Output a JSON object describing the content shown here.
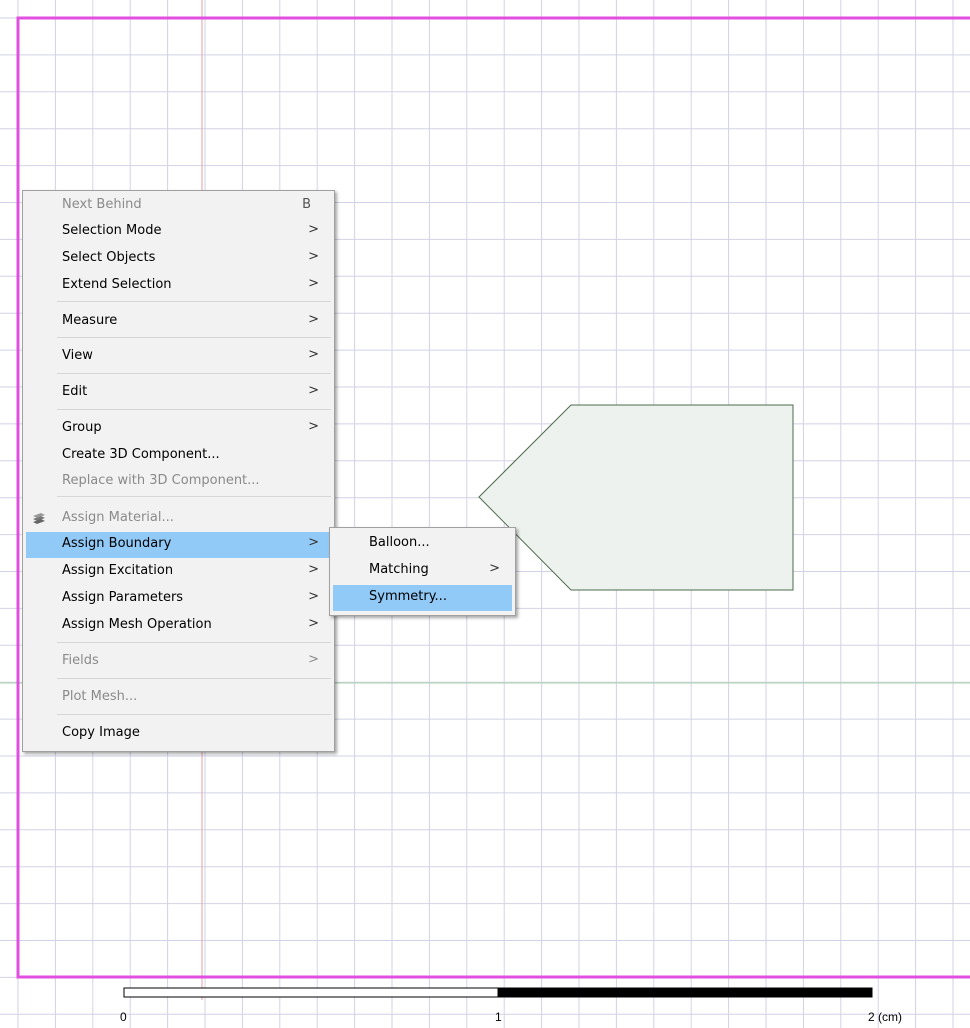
{
  "colors": {
    "grid": "#d2d2e6",
    "frame": "#e04fe0",
    "x_axis": "#a8d2a8",
    "y_axis": "#e6a0a0",
    "shape_fill": "#eef2ee",
    "shape_stroke": "#4c6b4c",
    "menu_bg": "#f2f2f2",
    "highlight": "#91c9f7"
  },
  "context_menu": {
    "items": [
      {
        "label": "Next Behind",
        "shortcut": "B",
        "disabled": true
      },
      {
        "label": "Selection Mode",
        "arrow": ">"
      },
      {
        "label": "Select Objects",
        "arrow": ">"
      },
      {
        "label": "Extend Selection",
        "arrow": ">"
      },
      {
        "label": "Measure",
        "arrow": ">"
      },
      {
        "label": "View",
        "arrow": ">"
      },
      {
        "label": "Edit",
        "arrow": ">"
      },
      {
        "label": "Group",
        "arrow": ">"
      },
      {
        "label": "Create 3D Component..."
      },
      {
        "label": "Replace with 3D Component...",
        "disabled": true
      },
      {
        "label": "Assign Material...",
        "disabled": true,
        "icon": "material-icon"
      },
      {
        "label": "Assign Boundary",
        "arrow": ">",
        "highlighted": true
      },
      {
        "label": "Assign Excitation",
        "arrow": ">"
      },
      {
        "label": "Assign Parameters",
        "arrow": ">"
      },
      {
        "label": "Assign Mesh Operation",
        "arrow": ">"
      },
      {
        "label": "Fields",
        "arrow": ">",
        "disabled": true
      },
      {
        "label": "Plot Mesh...",
        "disabled": true
      },
      {
        "label": "Copy Image"
      }
    ]
  },
  "boundary_submenu": {
    "items": [
      {
        "label": "Balloon..."
      },
      {
        "label": "Matching",
        "arrow": ">"
      },
      {
        "label": "Symmetry...",
        "highlighted": true
      }
    ]
  },
  "scale_bar": {
    "labels": [
      "0",
      "1",
      "2 (cm)"
    ]
  }
}
